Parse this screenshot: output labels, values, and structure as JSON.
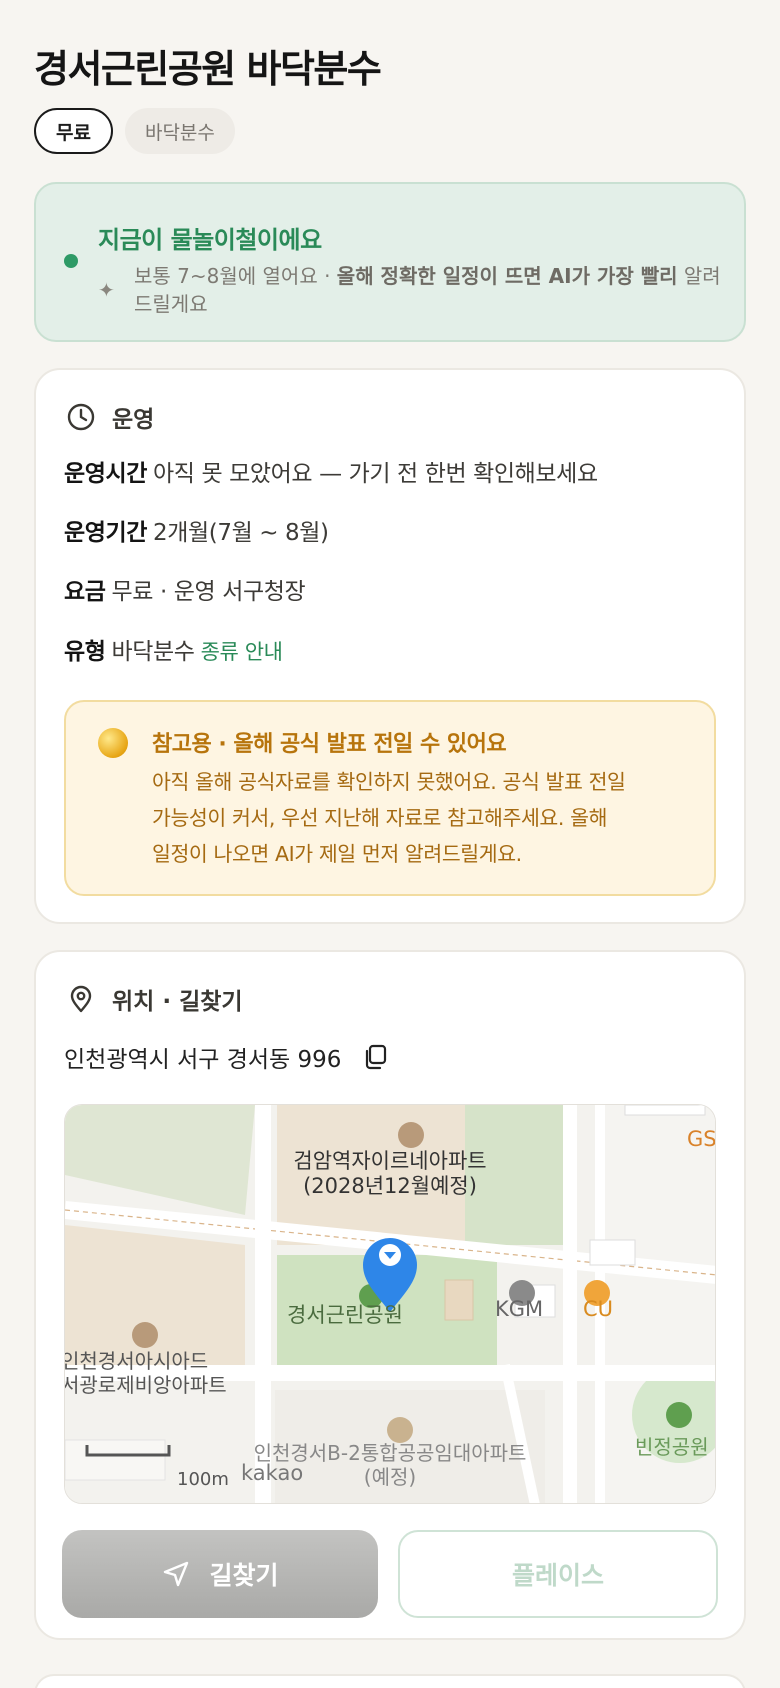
{
  "page": {
    "title": "경서근린공원 바닥분수",
    "chips": [
      "무료",
      "바닥분수"
    ]
  },
  "season": {
    "headline": "지금이 물놀이철이에요",
    "desc_normal": "보통 7~8월에 열어요 · ",
    "desc_bold": "올해 정확한 일정이 뜨면 AI가 가장 빨리",
    "desc_tail": "알려드릴게요",
    "accent": "#2e9a66"
  },
  "operation": {
    "heading": "운영",
    "rows": [
      {
        "key": "운영시간",
        "value": "아직 못 모았어요 — 가기 전 한번 확인해보세요"
      },
      {
        "key": "운영기간",
        "value": "2개월(7월 ~ 8월)"
      },
      {
        "key": "요금",
        "value": "무료 · 운영 서구청장"
      },
      {
        "key": "유형",
        "value": "바닥분수",
        "link": "종류 안내"
      }
    ],
    "notice": {
      "title": "참고용 · 올해 공식 발표 전일 수 있어요",
      "lines": [
        "아직 올해 공식자료를 확인하지 못했어요. 공식 발표 전일",
        "가능성이 커서, 우선 지난해 자료로 참고해주세요. 올해",
        "일정이 나오면 AI가 제일 먼저 알려드릴게요."
      ]
    }
  },
  "location": {
    "heading": "위치 · 길찾기",
    "address": "인천광역시 서구 경서동 996",
    "map": {
      "labels": {
        "apt_top_1": "검암역자이르네아파트",
        "apt_top_2": "(2028년12월예정)",
        "park": "경서근린공원",
        "kgm": "KGM",
        "cu": "CU",
        "gs": "GS",
        "apt_left_1": "인천경서아시아드",
        "apt_left_2": "서광로제비앙아파트",
        "apt_bottom_1": "인천경서B-2통합공공임대아파트",
        "apt_bottom_2": "(예정)",
        "park_right": "빈정공원",
        "scale": "100m",
        "brand": "kakao"
      }
    },
    "buttons": {
      "directions": "길찾기",
      "place": "플레이스"
    }
  }
}
